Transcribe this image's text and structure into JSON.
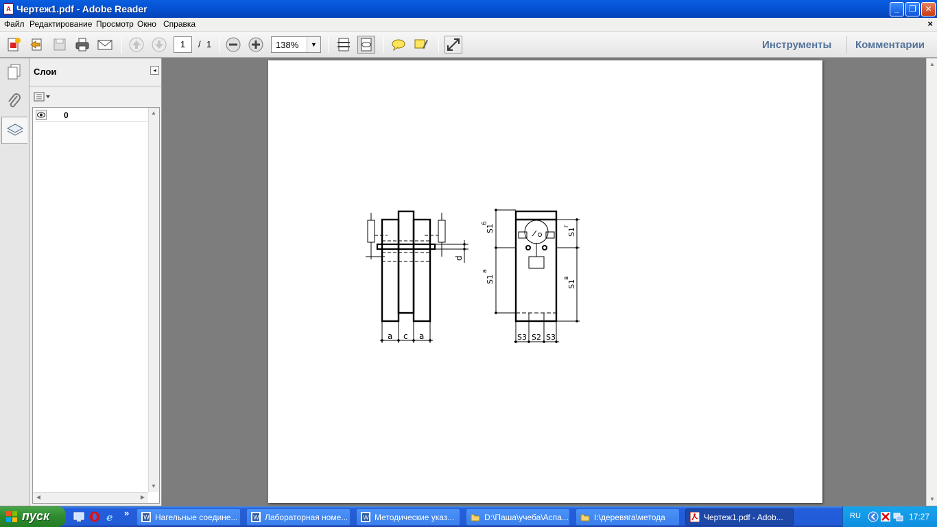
{
  "window": {
    "title": "Чертеж1.pdf - Adobe Reader",
    "icon": "adobe-reader-icon",
    "controls": [
      "minimize-icon",
      "restore-icon",
      "close-icon"
    ]
  },
  "menu": {
    "items": [
      "Файл",
      "Редактирование",
      "Просмотр",
      "Окно",
      "Справка"
    ],
    "close_symbol": "×"
  },
  "toolbar": {
    "buttons": [
      "create-pdf-icon",
      "open-icon",
      "save-icon",
      "print-icon",
      "email-icon",
      "previous-page-icon",
      "next-page-icon",
      "zoom-out-icon",
      "zoom-in-icon",
      "fit-page-icon",
      "fit-width-icon",
      "comment-icon",
      "highlight-icon",
      "full-screen-icon"
    ],
    "current_page": "1",
    "page_separator": "/",
    "total_pages": "1",
    "zoom": "138%",
    "tools_label": "Инструменты",
    "comments_label": "Комментарии"
  },
  "sidebar": {
    "rail": [
      "pages-icon",
      "attachments-icon",
      "layers-icon"
    ],
    "active": "layers-icon",
    "panel_title": "Слои",
    "layers": [
      {
        "name": "0",
        "visible": true
      }
    ]
  },
  "drawing": {
    "labels": {
      "a1": "a",
      "c": "c",
      "a2": "a",
      "d": "d",
      "s1b": "S1",
      "s1b_sup": "б",
      "s1a": "S1",
      "s1a_sup": "а",
      "s1g": "S1",
      "s1g_sup": "г",
      "s1v": "S1",
      "s1v_sup": "в",
      "s3a": "S3",
      "s2": "S2",
      "s3b": "S3"
    }
  },
  "taskbar": {
    "start_label": "пуск",
    "quick_launch": [
      "show-desktop-icon",
      "opera-icon",
      "ie-icon",
      "firefox-icon"
    ],
    "more": "»",
    "tasks": [
      {
        "label": "Нагельные соедине...",
        "icon": "word-icon",
        "active": false
      },
      {
        "label": "Лабораторная номе...",
        "icon": "word-icon",
        "active": false
      },
      {
        "label": "Методические указ...",
        "icon": "word-icon",
        "active": false
      },
      {
        "label": "D:\\Паша\\учеба\\Аспа...",
        "icon": "folder-icon",
        "active": false
      },
      {
        "label": "I:\\деревяга\\метода",
        "icon": "folder-icon",
        "active": false
      },
      {
        "label": "Чертеж1.pdf - Adob...",
        "icon": "adobe-reader-icon",
        "active": true
      }
    ],
    "tray": {
      "language": "RU",
      "icons": [
        "tray-arrow-icon",
        "tray-antivirus-icon",
        "tray-network-icon",
        "tray-volume-icon"
      ],
      "clock": "17:27"
    }
  }
}
